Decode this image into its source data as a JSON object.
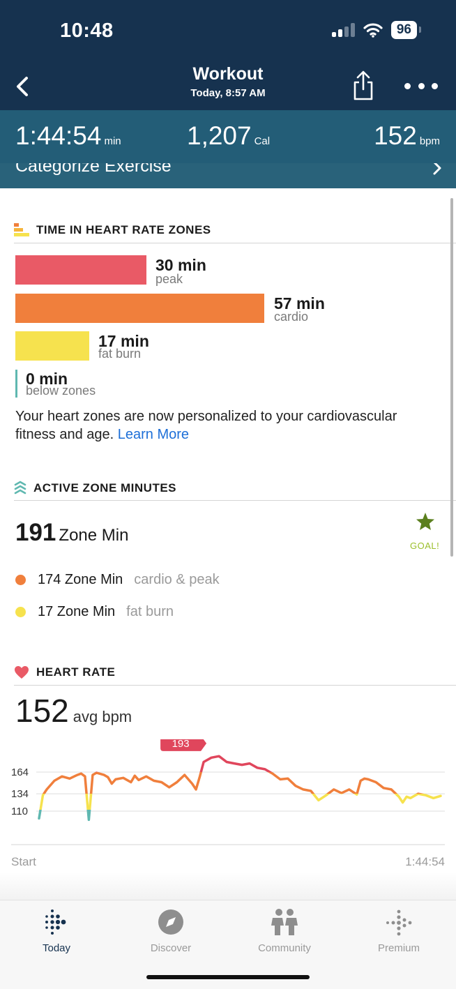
{
  "status_bar": {
    "time": "10:48",
    "battery": "96"
  },
  "header": {
    "title": "Workout",
    "subtitle": "Today, 8:57 AM"
  },
  "stats": {
    "duration": "1:44:54",
    "duration_unit": "min",
    "calories": "1,207",
    "calories_unit": "Cal",
    "heart_rate": "152",
    "heart_rate_unit": "bpm"
  },
  "categorize": {
    "label": "Categorize Exercise"
  },
  "heart_rate_zones": {
    "title": "TIME IN HEART RATE ZONES",
    "zones": [
      {
        "value": "30 min",
        "label": "peak",
        "minutes": 30,
        "color": "#e95a66"
      },
      {
        "value": "57 min",
        "label": "cardio",
        "minutes": 57,
        "color": "#f07f3c"
      },
      {
        "value": "17 min",
        "label": "fat burn",
        "minutes": 17,
        "color": "#f6e24e"
      },
      {
        "value": "0 min",
        "label": "below zones",
        "minutes": 0,
        "color": "#5fb8b0"
      }
    ],
    "info_text": "Your heart zones are now personalized to your cardiovascular fitness and age.",
    "learn_more": "Learn More"
  },
  "active_zone_minutes": {
    "title": "ACTIVE ZONE MINUTES",
    "total": "191",
    "total_label": "Zone Min",
    "goal_label": "GOAL!",
    "rows": [
      {
        "value": "174 Zone Min",
        "label": "cardio & peak",
        "color": "#f07f3c"
      },
      {
        "value": "17 Zone Min",
        "label": "fat burn",
        "color": "#f6e24e"
      }
    ]
  },
  "heart_rate": {
    "title": "HEART RATE",
    "avg": "152",
    "avg_label": "avg bpm",
    "start_label": "Start",
    "end_label": "1:44:54"
  },
  "chart_data": {
    "type": "line",
    "title": "HEART RATE",
    "yticks": [
      "164",
      "134",
      "110"
    ],
    "ylim": [
      90,
      205
    ],
    "xlabels": [
      "Start",
      "1:44:54"
    ],
    "peak_annotation": {
      "label": "193",
      "x_min": 43,
      "y": 193
    },
    "zone_thresholds": {
      "fat_burn": 134,
      "peak": 164
    },
    "series": [
      {
        "x_minutes": [
          0,
          1,
          2,
          4,
          6,
          8,
          10,
          11,
          12,
          13,
          14,
          15,
          17,
          18,
          19,
          20,
          22,
          24,
          25,
          26,
          28,
          30,
          32,
          34,
          36,
          37,
          38,
          40,
          41,
          42,
          43,
          45,
          47,
          49,
          51,
          53,
          55,
          57,
          59,
          61,
          63,
          65,
          67,
          69,
          71,
          73,
          75,
          77,
          79,
          81,
          83,
          84,
          85,
          86,
          88,
          90,
          92,
          94,
          95,
          96,
          97,
          99,
          101,
          103,
          104.9
        ],
        "values": [
          100,
          132,
          140,
          152,
          158,
          155,
          160,
          162,
          158,
          98,
          160,
          163,
          160,
          157,
          148,
          154,
          156,
          150,
          159,
          153,
          158,
          152,
          150,
          143,
          150,
          155,
          160,
          148,
          140,
          158,
          178,
          184,
          186,
          178,
          176,
          174,
          176,
          170,
          168,
          162,
          154,
          155,
          145,
          140,
          138,
          125,
          132,
          140,
          135,
          140,
          133,
          152,
          155,
          154,
          150,
          142,
          140,
          130,
          122,
          130,
          128,
          134,
          132,
          128,
          131
        ]
      }
    ]
  },
  "tabs": [
    {
      "label": "Today",
      "active": true
    },
    {
      "label": "Discover",
      "active": false
    },
    {
      "label": "Community",
      "active": false
    },
    {
      "label": "Premium",
      "active": false
    }
  ],
  "colors": {
    "header_bg": "#16324f",
    "stats_bg": "#235d77",
    "peak": "#e95a66",
    "cardio": "#f07f3c",
    "fat_burn": "#f6e24e",
    "below_zones": "#5fb8b0",
    "link": "#1d6fd8",
    "goal": "#9bbf2b"
  }
}
